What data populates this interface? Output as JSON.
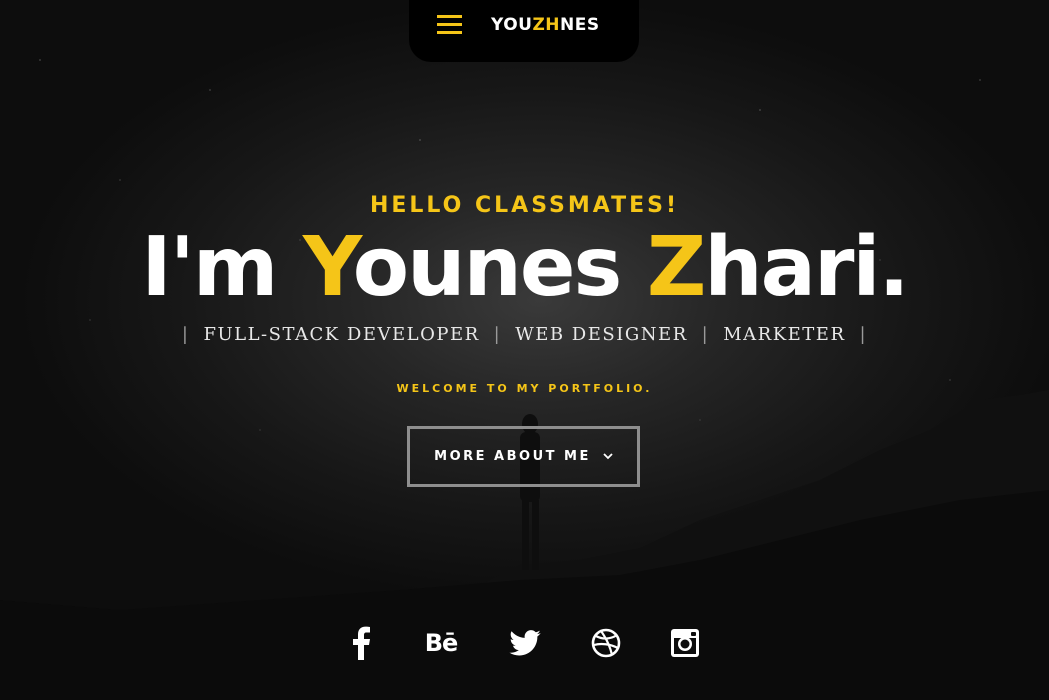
{
  "header": {
    "logo_part1": "YOU",
    "logo_accent": "ZH",
    "logo_part2": "NES"
  },
  "hero": {
    "greeting": "HELLO CLASSMATES!",
    "headline_prefix": "I'm ",
    "headline_first_initial": "Y",
    "headline_first_rest": "ounes ",
    "headline_last_initial": "Z",
    "headline_last_rest": "hari.",
    "roles": [
      "FULL-STACK DEVELOPER",
      "WEB DESIGNER",
      "MARKETER"
    ],
    "role_separator": "|",
    "welcome": "WELCOME TO MY PORTFOLIO.",
    "cta_label": "MORE ABOUT ME"
  },
  "social": {
    "behance_label": "Bē",
    "items": [
      "facebook-icon",
      "behance-icon",
      "twitter-icon",
      "dribbble-icon",
      "instagram-icon"
    ]
  },
  "colors": {
    "accent": "#f5c518",
    "background": "#0d0d0d",
    "text": "#ffffff",
    "button_border": "#8e8e8e"
  }
}
